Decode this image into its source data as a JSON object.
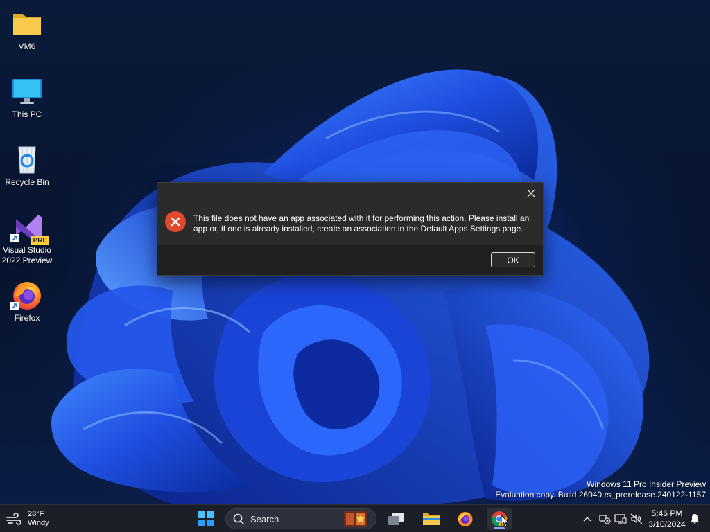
{
  "desktop": {
    "icons": [
      {
        "label": "VM6",
        "icon": "folder-icon"
      },
      {
        "label": "This PC",
        "icon": "monitor-icon"
      },
      {
        "label": "Recycle Bin",
        "icon": "recycle-bin-icon"
      },
      {
        "label": "Visual Studio 2022 Preview",
        "icon": "visual-studio-icon",
        "badge": "PRE"
      },
      {
        "label": "Firefox",
        "icon": "firefox-icon"
      }
    ],
    "watermark": {
      "line1": "Windows 11 Pro Insider Preview",
      "line2": "Evaluation copy. Build 26040.rs_prerelease.240122-1157"
    }
  },
  "dialog": {
    "message": "This file does not have an app associated with it for performing this action. Please install an app or, if one is already installed, create an association in the Default Apps Settings page.",
    "ok_label": "OK",
    "close_icon": "close-icon",
    "status_icon": "error-icon"
  },
  "taskbar": {
    "weather": {
      "temperature": "28°F",
      "condition": "Windy",
      "icon": "wind-icon"
    },
    "search_placeholder": "Search",
    "apps": [
      "start-icon",
      "task-view-icon",
      "file-explorer-icon",
      "firefox-icon",
      "chrome-icon"
    ],
    "active_app": "chrome-icon",
    "tray_icons": [
      "chevron-up-icon",
      "network-disconnected-icon",
      "display-icon",
      "volume-muted-icon",
      "bell-icon"
    ],
    "clock": {
      "time": "5:46 PM",
      "date": "3/10/2024"
    }
  },
  "colors": {
    "taskbar_bg": "#1c1f28",
    "dialog_bg": "#2b2b2b",
    "dialog_footer_bg": "#202020",
    "error_red": "#e0492b",
    "wallpaper_blue": "#1f4fe0"
  }
}
